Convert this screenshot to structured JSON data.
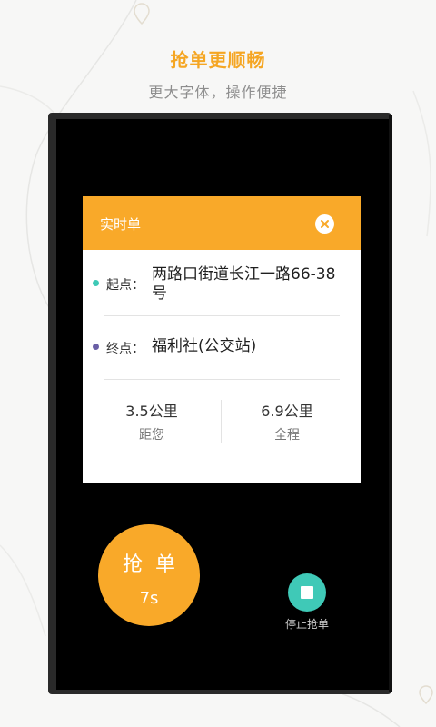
{
  "promo": {
    "headline": "抢单更顺畅",
    "subline": "更大字体，操作便捷"
  },
  "order_card": {
    "title": "实时单",
    "close_icon": "close-icon",
    "start": {
      "label": "起点：",
      "address_line1": "两路口街道长江一路66-38",
      "address_line2": "号",
      "dot_color": "#3ec9b6"
    },
    "end": {
      "label": "终点：",
      "address": "福利社(公交站)",
      "dot_color": "#6a5fa6"
    },
    "distance_to_you": {
      "value": "3.5公里",
      "label": "距您"
    },
    "total_distance": {
      "value": "6.9公里",
      "label": "全程"
    }
  },
  "grab_button": {
    "label": "抢单",
    "countdown": "7s"
  },
  "stop_button": {
    "icon": "stop-icon",
    "label": "停止抢单"
  },
  "colors": {
    "accent": "#f9a929",
    "teal": "#3fc9b7",
    "background": "#f7f7f6"
  }
}
